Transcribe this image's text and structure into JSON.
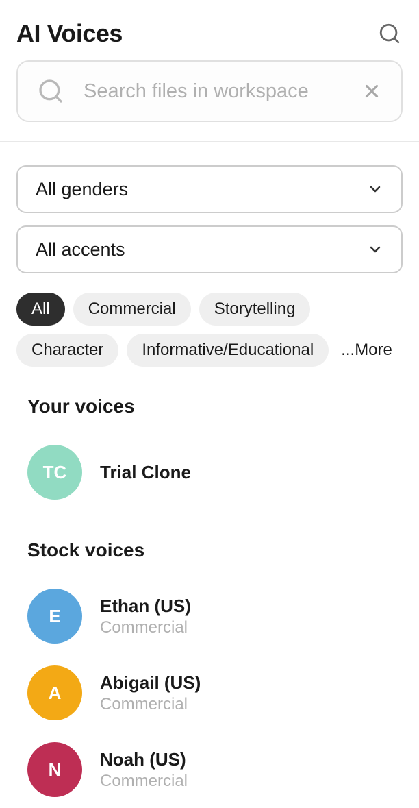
{
  "header": {
    "title": "AI Voices"
  },
  "search": {
    "placeholder": "Search files in workspace"
  },
  "filters": {
    "gender": {
      "selected": "All genders"
    },
    "accent": {
      "selected": "All accents"
    }
  },
  "chips": [
    {
      "label": "All",
      "active": true
    },
    {
      "label": "Commercial",
      "active": false
    },
    {
      "label": "Storytelling",
      "active": false
    },
    {
      "label": "Character",
      "active": false
    },
    {
      "label": "Informative/Educational",
      "active": false
    }
  ],
  "more_label": "...More",
  "your_voices": {
    "title": "Your voices",
    "items": [
      {
        "initials": "TC",
        "name": "Trial Clone",
        "tag": "",
        "color": "#91dbc2"
      }
    ]
  },
  "stock_voices": {
    "title": "Stock voices",
    "items": [
      {
        "initials": "E",
        "name": "Ethan (US)",
        "tag": "Commercial",
        "color": "#5ba7de"
      },
      {
        "initials": "A",
        "name": "Abigail (US)",
        "tag": "Commercial",
        "color": "#f3a915"
      },
      {
        "initials": "N",
        "name": "Noah (US)",
        "tag": "Commercial",
        "color": "#be2e54"
      }
    ]
  }
}
